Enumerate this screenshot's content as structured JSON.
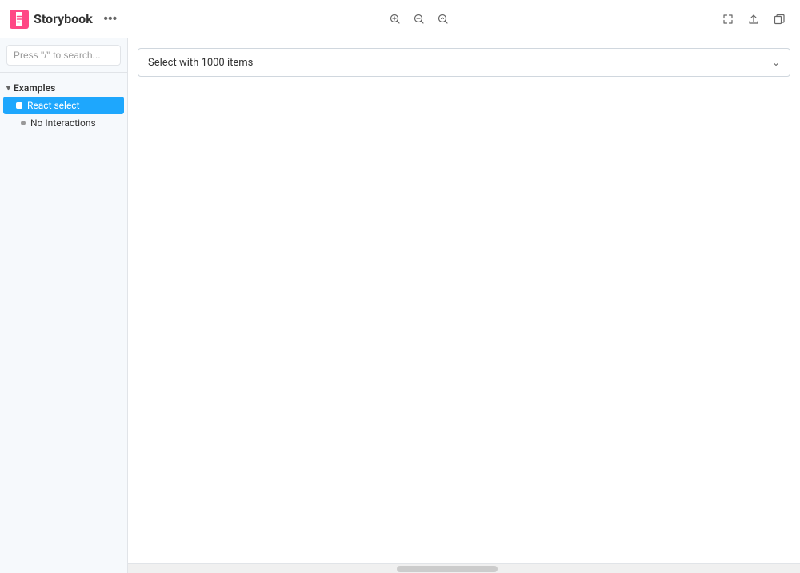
{
  "header": {
    "title": "Storybook",
    "more_button_label": "···",
    "toolbar": {
      "zoom_in_label": "⊕",
      "zoom_out_label": "⊖",
      "zoom_reset_label": "⊙"
    },
    "actions": {
      "fullscreen_label": "⤢",
      "share_label": "↑",
      "copy_label": "❐"
    }
  },
  "sidebar": {
    "search_placeholder": "Press \"/\" to search...",
    "nav": {
      "group_label": "Examples",
      "items": [
        {
          "label": "React select",
          "active": true,
          "sub_items": []
        },
        {
          "label": "No Interactions",
          "active": false,
          "sub_items": []
        }
      ]
    }
  },
  "preview": {
    "select_value": "Select with 1000 items",
    "select_arrow": "⌄"
  },
  "colors": {
    "accent": "#1ea7fd",
    "border": "#e1e4e8",
    "sidebar_bg": "#f6f9fc"
  }
}
